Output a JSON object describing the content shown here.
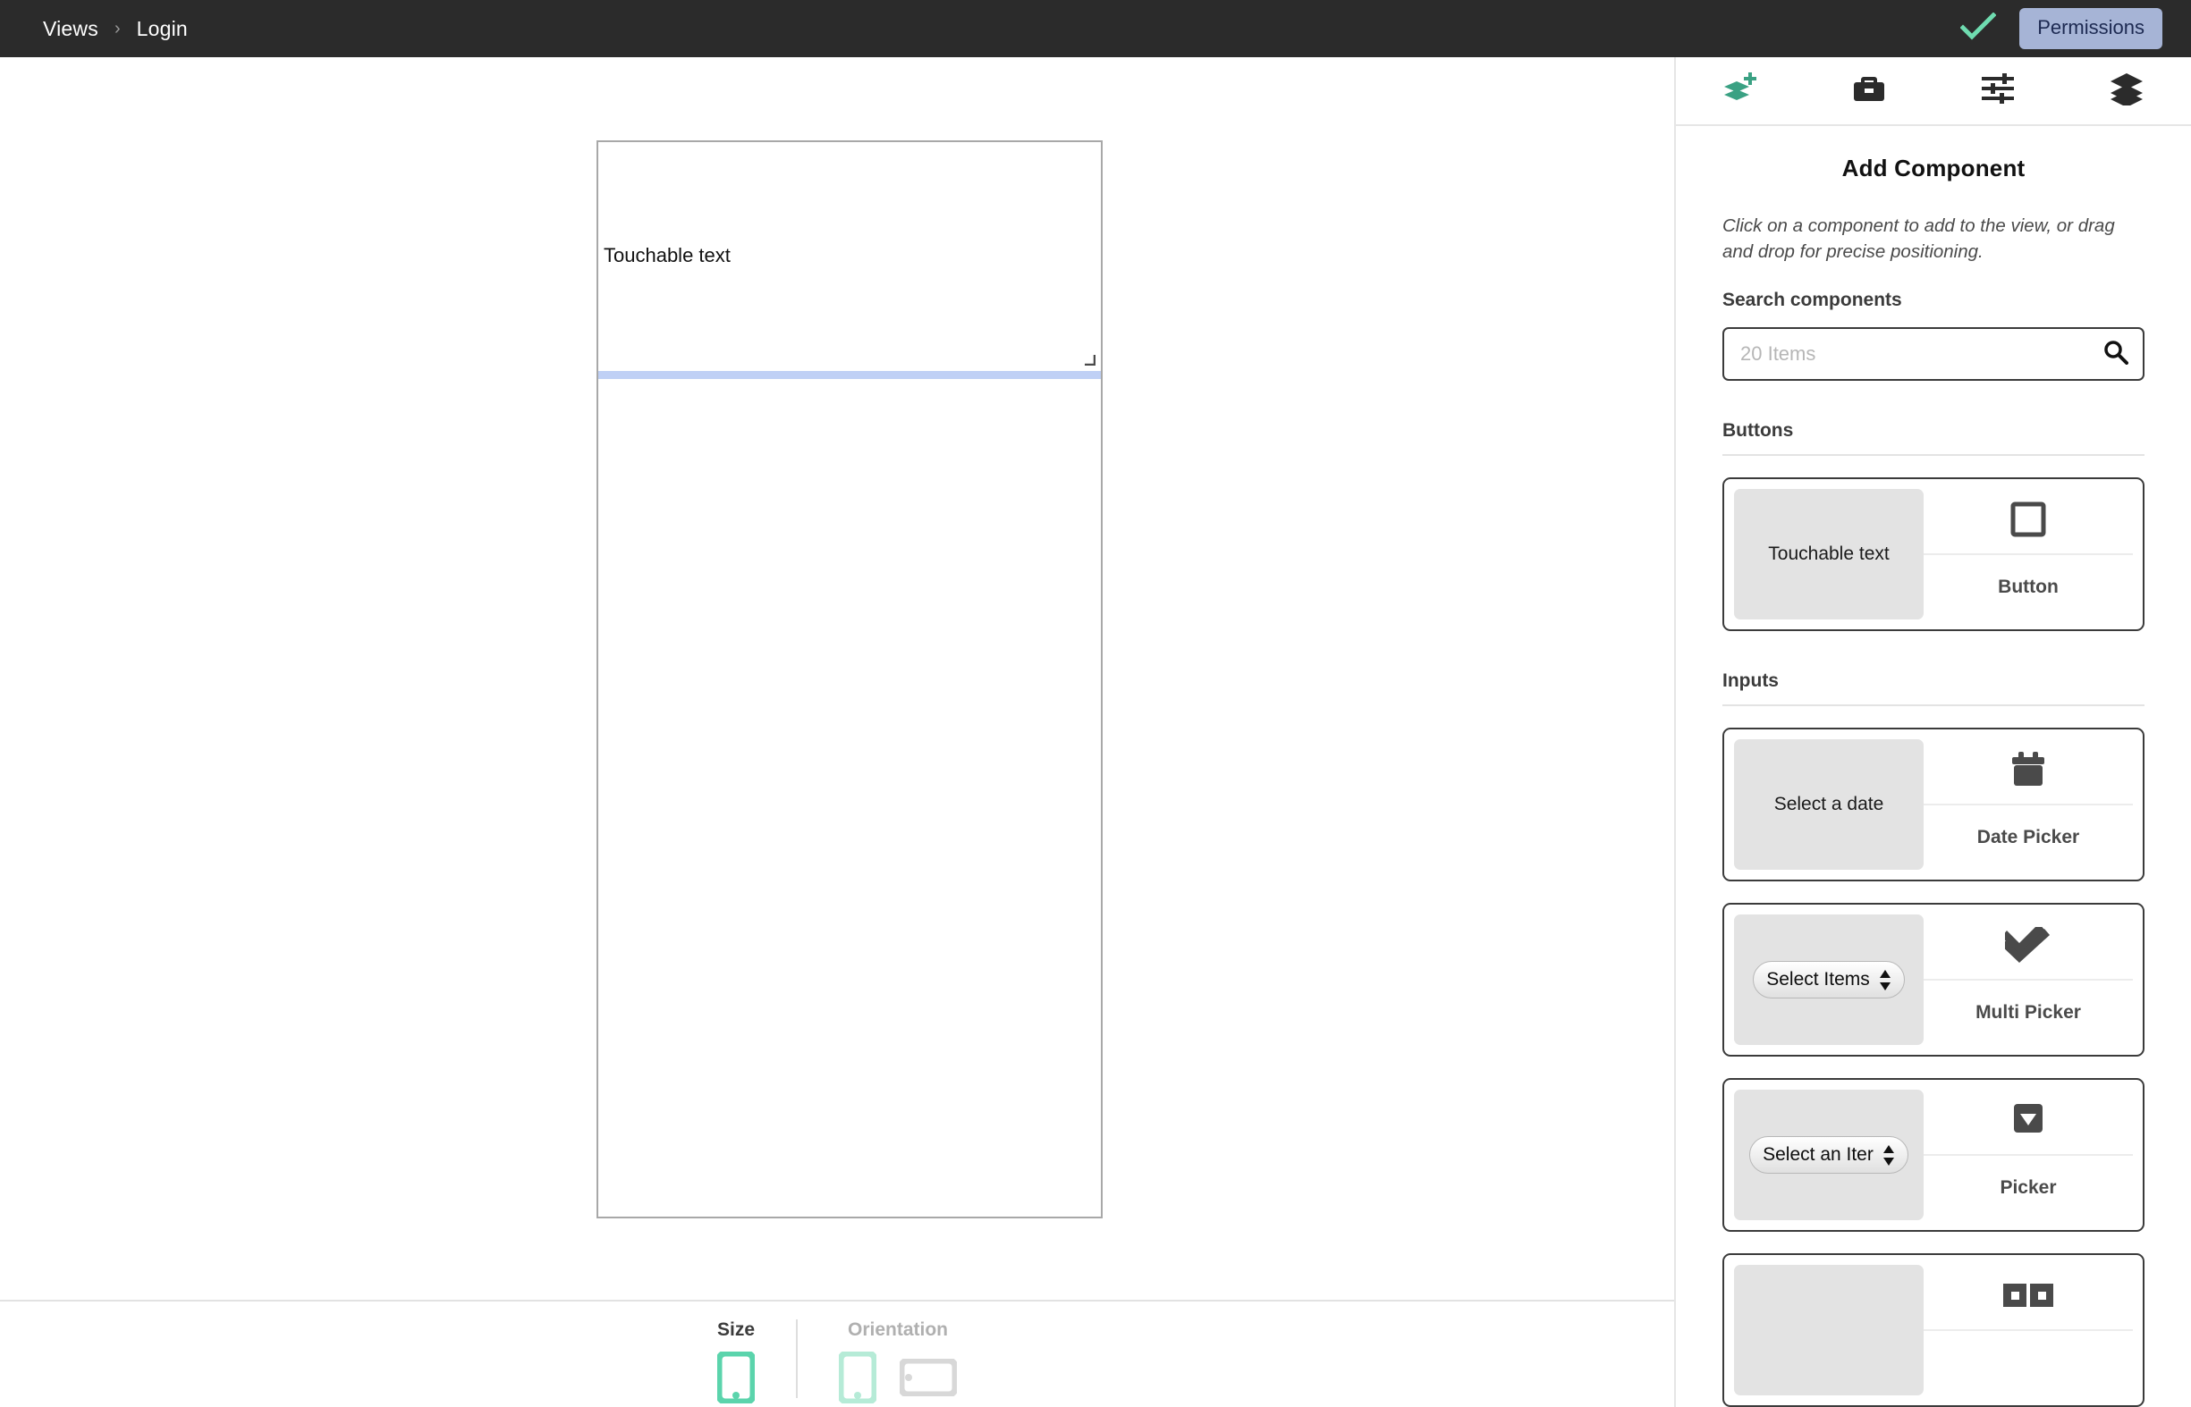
{
  "topbar": {
    "breadcrumb": [
      "Views",
      "Login"
    ],
    "separator": "›",
    "check_icon": "check-icon",
    "permissions_label": "Permissions",
    "permissions_bg": "#a6b4d6",
    "permissions_fg": "#1d2a52",
    "background": "#2b2b2b"
  },
  "canvas": {
    "device_element_label": "Touchable text",
    "drop_indicator_color": "#bfd0f5",
    "frame_border_color": "#a8a8a8"
  },
  "bottombar": {
    "size": {
      "label": "Size",
      "icons": [
        {
          "name": "phone-portrait-icon",
          "state": "active",
          "color": "#5bd4ac"
        }
      ]
    },
    "orientation": {
      "label": "Orientation",
      "icons": [
        {
          "name": "phone-portrait-icon",
          "state": "selected",
          "color": "#b6ebd7"
        },
        {
          "name": "tablet-landscape-icon",
          "state": "inactive",
          "color": "#d8d8d8"
        }
      ]
    }
  },
  "panel": {
    "tabs": [
      {
        "name": "add-component-tab",
        "icon": "layers-plus-icon",
        "active": true,
        "color": "#3aa183"
      },
      {
        "name": "toolbox-tab",
        "icon": "toolbox-icon",
        "active": false,
        "color": "#2b2b2b"
      },
      {
        "name": "settings-tab",
        "icon": "sliders-icon",
        "active": false,
        "color": "#2b2b2b"
      },
      {
        "name": "layers-tab",
        "icon": "layers-stack-icon",
        "active": false,
        "color": "#2b2b2b"
      }
    ],
    "title": "Add Component",
    "hint": "Click on a component to add to the view, or drag and drop for precise positioning.",
    "search": {
      "label": "Search components",
      "value": "",
      "placeholder": "20 Items",
      "icon": "search-icon"
    },
    "sections": [
      {
        "title": "Buttons",
        "components": [
          {
            "preview": "Touchable text",
            "preview_type": "text",
            "name": "Button",
            "icon": "square-outline-icon"
          }
        ]
      },
      {
        "title": "Inputs",
        "components": [
          {
            "preview": "Select a date",
            "preview_type": "text",
            "name": "Date Picker",
            "icon": "calendar-icon"
          },
          {
            "preview": "Select Items",
            "preview_type": "select",
            "name": "Multi Picker",
            "icon": "double-check-icon"
          },
          {
            "preview": "Select an Iter",
            "preview_type": "select",
            "name": "Picker",
            "icon": "dropdown-triangle-icon"
          },
          {
            "preview": "",
            "preview_type": "blank",
            "name": "",
            "icon": "radio-group-icon"
          }
        ]
      }
    ]
  }
}
